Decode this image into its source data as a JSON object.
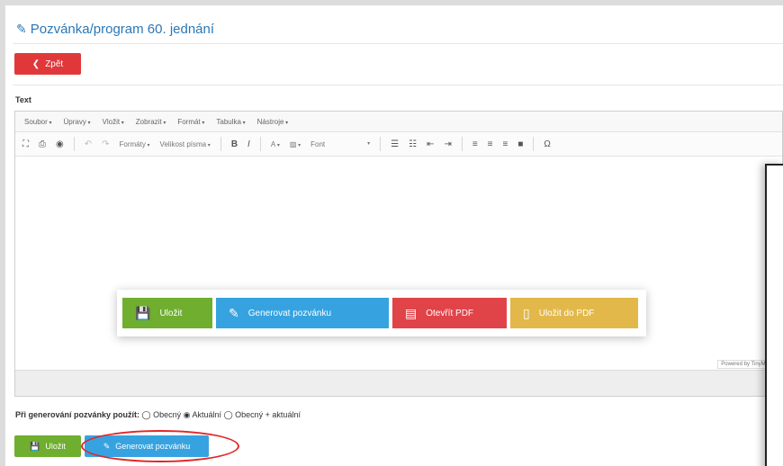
{
  "page": {
    "title": "Pozvánka/program 60. jednání",
    "title_icon": "edit-icon"
  },
  "back_button": {
    "label": "Zpět",
    "icon": "chevron-left-icon"
  },
  "text_label": "Text",
  "editor": {
    "menu": [
      "Soubor",
      "Úpravy",
      "Vložit",
      "Zobrazit",
      "Formát",
      "Tabulka",
      "Nástroje"
    ],
    "toolbar": {
      "formats_label": "Formáty",
      "size_label": "Velikost písma",
      "bold": "B",
      "italic": "I",
      "font_label": "Font",
      "omega": "Ω"
    },
    "wordcount": "Powered by TinyMCE"
  },
  "callout_buttons": [
    {
      "label": "Uložit",
      "icon": "save-icon",
      "color": "#6fae2e"
    },
    {
      "label": "Generovat pozvánku",
      "icon": "magic-wand-icon",
      "color": "#36a3e0"
    },
    {
      "label": "Otevřít PDF",
      "icon": "pdf-icon",
      "color": "#e04449"
    },
    {
      "label": "Uložit do PDF",
      "icon": "file-icon",
      "color": "#e2b84b"
    }
  ],
  "send_options": {
    "label": "Při generování pozvánky použít:",
    "options": [
      "Obecný",
      "Aktuální",
      "Obecný + aktuální"
    ]
  },
  "bottom_buttons": {
    "save": "Uložit",
    "generate": "Generovat pozvánku"
  },
  "colors": {
    "accent_red": "#e0383a",
    "accent_blue": "#36a3e0",
    "accent_green": "#6fae2e",
    "highlight_oval": "#e0262a"
  }
}
